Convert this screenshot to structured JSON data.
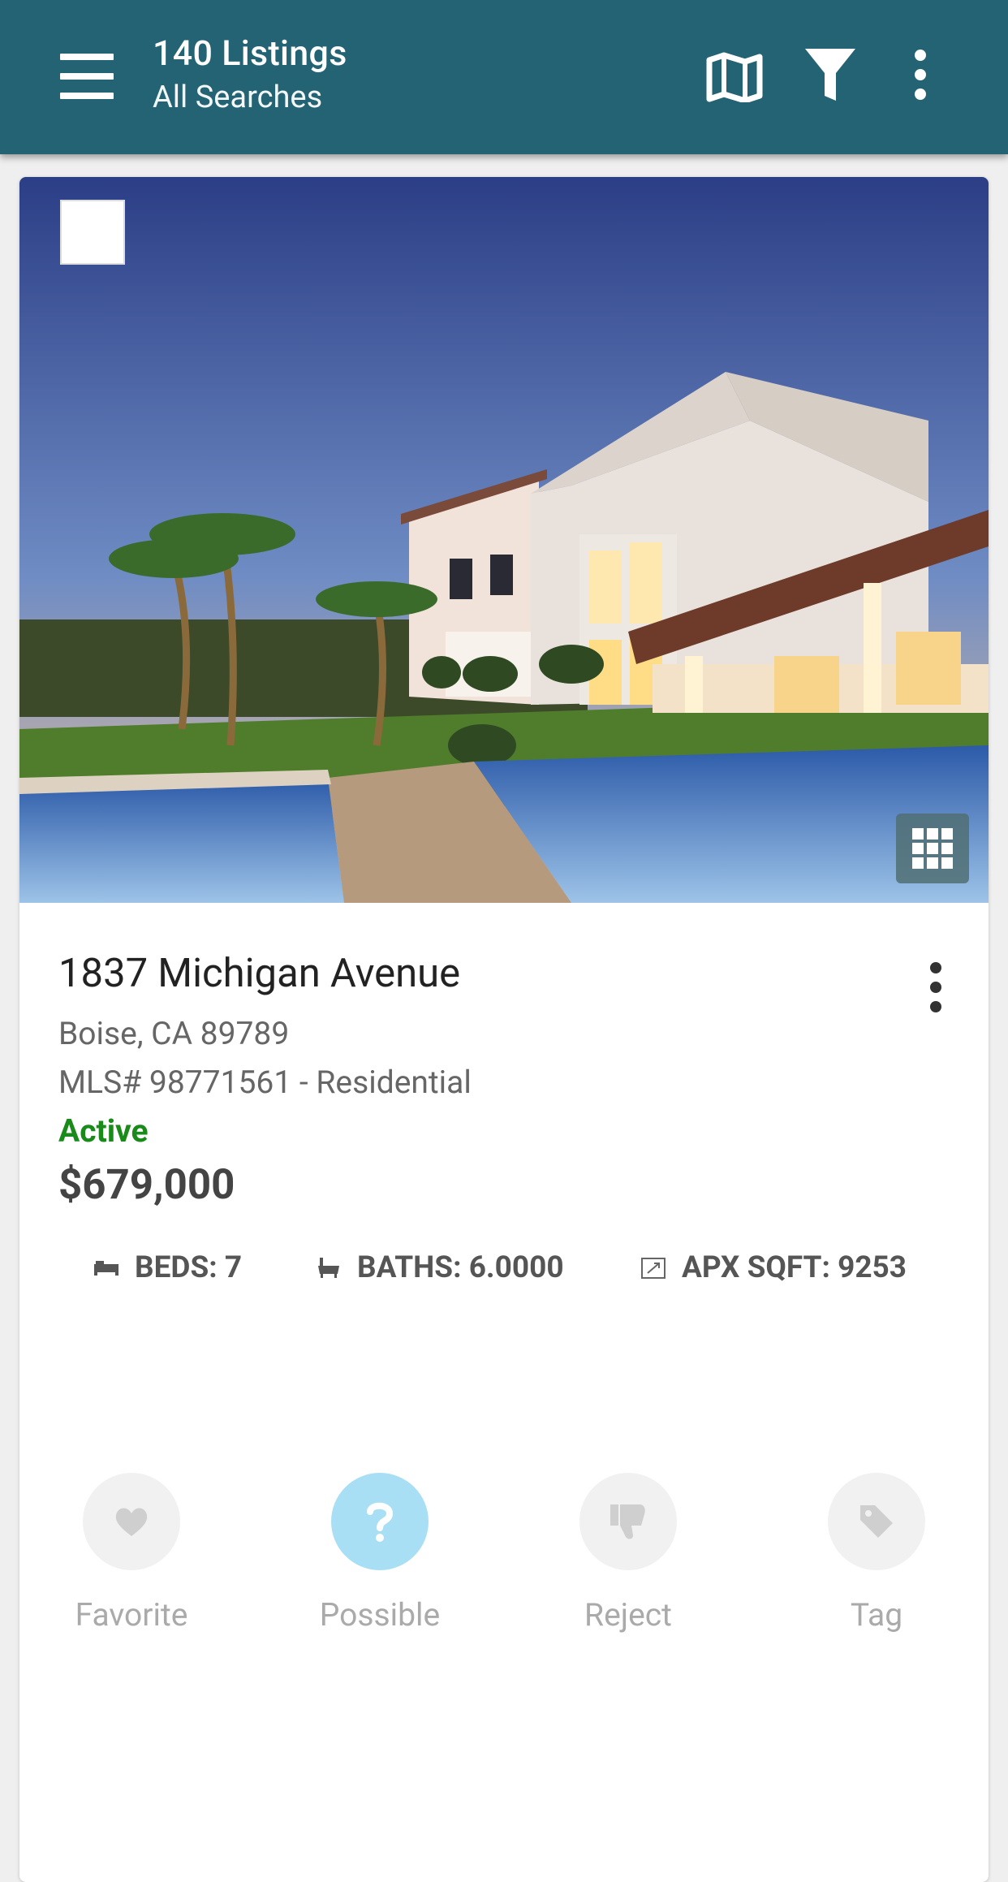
{
  "app_bar": {
    "title": "140 Listings",
    "subtitle": "All Searches",
    "icons": [
      "menu-icon",
      "map-icon",
      "filter-icon",
      "more-vert-icon"
    ],
    "background": "#246374"
  },
  "listing": {
    "address": "1837 Michigan Avenue",
    "city_line": "Boise, CA 89789",
    "mls_line": "MLS# 98771561 - Residential",
    "status": "Active",
    "status_color": "#1a8a1a",
    "price": "$679,000",
    "specs": {
      "beds": "BEDS: 7",
      "baths": "BATHS: 6.0000",
      "sqft": "APX SQFT: 9253"
    }
  },
  "actions": [
    {
      "label": "Favorite",
      "icon": "heart-icon",
      "selected": false
    },
    {
      "label": "Possible",
      "icon": "question-icon",
      "selected": true
    },
    {
      "label": "Reject",
      "icon": "thumbs-down-icon",
      "selected": false
    },
    {
      "label": "Tag",
      "icon": "tag-icon",
      "selected": false
    }
  ]
}
